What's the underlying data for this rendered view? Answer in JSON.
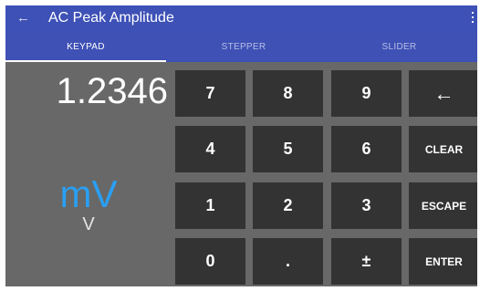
{
  "app_bar": {
    "back_icon": "arrow-left-icon",
    "back_glyph": "←",
    "title": "AC Peak Amplitude",
    "menu_icon": "more-vertical-icon"
  },
  "tabs": [
    {
      "label": "KEYPAD",
      "active": true
    },
    {
      "label": "STEPPER",
      "active": false
    },
    {
      "label": "SLIDER",
      "active": false
    }
  ],
  "display": {
    "value": "1.2346",
    "unit_selected": "mV",
    "unit_alt": "V"
  },
  "keypad": {
    "k7": "7",
    "k8": "8",
    "k9": "9",
    "backspace": "←",
    "k4": "4",
    "k5": "5",
    "k6": "6",
    "clear": "CLEAR",
    "k1": "1",
    "k2": "2",
    "k3": "3",
    "escape": "ESCAPE",
    "k0": "0",
    "decimal": ".",
    "plus_minus": "±",
    "enter": "ENTER"
  },
  "colors": {
    "app_bar": "#3d51b6",
    "background": "#686868",
    "key": "#333333",
    "unit_accent": "#2a9ff3"
  }
}
